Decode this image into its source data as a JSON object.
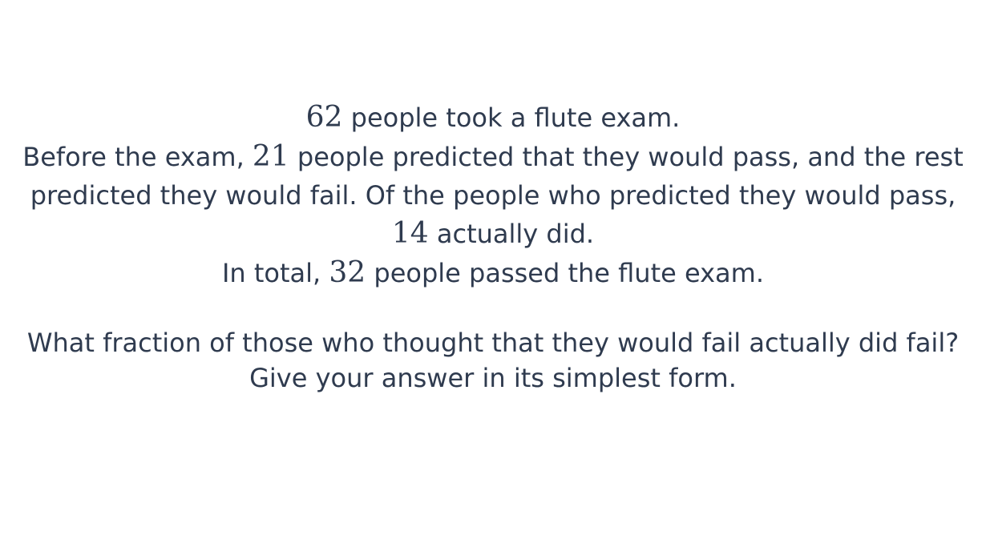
{
  "statement": {
    "line1": {
      "num": "62",
      "text": " people took a flute exam."
    },
    "line2": {
      "pre": "Before the exam, ",
      "num": "21",
      "post": " people predicted that they would pass, and the rest predicted they would fail. Of the people who predicted they would pass, ",
      "num2": "14",
      "end": " actually did."
    },
    "line3": {
      "pre": "In total, ",
      "num": "32",
      "post": " people passed the flute exam."
    }
  },
  "question": {
    "text": "What fraction of those who thought that they would fail actually did fail?",
    "instruction": "Give your answer in its simplest form."
  }
}
